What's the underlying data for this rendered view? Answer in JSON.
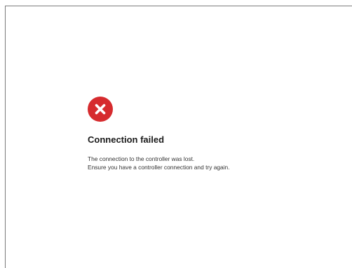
{
  "error": {
    "icon": "close-icon",
    "icon_color": "#d62b2e",
    "title": "Connection failed",
    "message_lines": [
      "The connection to the controller was lost.",
      "Ensure you have a controller connection and try again."
    ]
  }
}
